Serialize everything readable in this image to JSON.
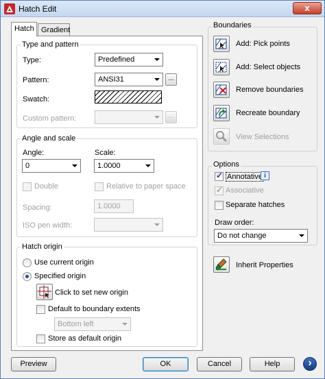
{
  "window": {
    "title": "Hatch Edit",
    "close_label": "x"
  },
  "tabs": [
    {
      "label": "Hatch"
    },
    {
      "label": "Gradient"
    }
  ],
  "type_pattern": {
    "title": "Type and pattern",
    "type_label": "Type:",
    "type_value": "Predefined",
    "pattern_label": "Pattern:",
    "pattern_value": "ANSI31",
    "browse_label": "...",
    "swatch_label": "Swatch:",
    "custom_label": "Custom pattern:",
    "custom_value": "",
    "custom_browse_label": "..."
  },
  "angle_scale": {
    "title": "Angle and scale",
    "angle_label": "Angle:",
    "angle_value": "0",
    "scale_label": "Scale:",
    "scale_value": "1.0000",
    "double_label": "Double",
    "relative_label": "Relative to paper space",
    "spacing_label": "Spacing:",
    "spacing_value": "1.0000",
    "iso_label": "ISO pen width:",
    "iso_value": ""
  },
  "origin": {
    "title": "Hatch origin",
    "use_current_label": "Use current origin",
    "specified_label": "Specified origin",
    "click_label": "Click to set new origin",
    "default_extents_label": "Default to boundary extents",
    "extent_value": "Bottom left",
    "store_label": "Store as default origin"
  },
  "boundaries": {
    "title": "Boundaries",
    "pick_points": "Add: Pick points",
    "select_objects": "Add: Select objects",
    "remove": "Remove boundaries",
    "recreate": "Recreate boundary",
    "view": "View Selections"
  },
  "options": {
    "title": "Options",
    "annotative_label": "Annotative",
    "info_label": "i",
    "associative_label": "Associative",
    "separate_label": "Separate hatches",
    "draw_order_label": "Draw order:",
    "draw_order_value": "Do not change",
    "inherit_label": "Inherit Properties"
  },
  "footer": {
    "preview": "Preview",
    "ok": "OK",
    "cancel": "Cancel",
    "help": "Help",
    "more": "›"
  },
  "colors": {
    "accent": "#1b4ea0",
    "title_bg": "#c3d7ef",
    "close": "#c7402b"
  }
}
